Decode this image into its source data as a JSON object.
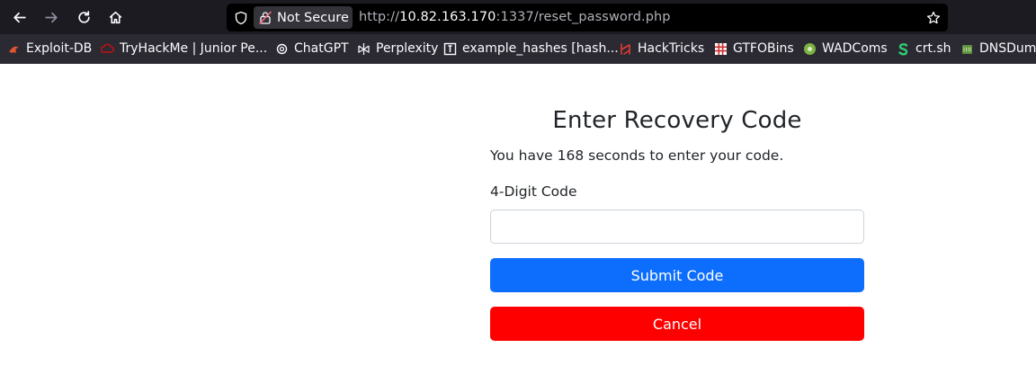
{
  "browser": {
    "security_label": "Not Secure",
    "url_prefix": "http://",
    "url_host": "10.82.163.170",
    "url_rest": ":1337/reset_password.php",
    "icons": {
      "back": "arrow-left-icon",
      "forward": "arrow-right-icon",
      "reload": "reload-icon",
      "home": "home-icon",
      "tracking": "shield-icon",
      "insecure": "lock-insecure-icon",
      "bookmark": "star-icon"
    }
  },
  "bookmarks": [
    {
      "label": "Exploit-DB",
      "icon": "exploit-db-icon",
      "color": "#e4572e"
    },
    {
      "label": "TryHackMe | Junior Pe...",
      "icon": "tryhackme-icon",
      "color": "#c11111"
    },
    {
      "label": "ChatGPT",
      "icon": "chatgpt-icon",
      "color": "#fbfbfe"
    },
    {
      "label": "Perplexity",
      "icon": "perplexity-icon",
      "color": "#fbfbfe"
    },
    {
      "label": "example_hashes [hash...",
      "icon": "hashcat-icon",
      "color": "#fbfbfe"
    },
    {
      "label": "HackTricks",
      "icon": "hacktricks-icon",
      "color": "#e03c31"
    },
    {
      "label": "GTFOBins",
      "icon": "gtfobins-icon",
      "color": "#d02d2d"
    },
    {
      "label": "WADComs",
      "icon": "wadcoms-icon",
      "color": "#7cb342"
    },
    {
      "label": "crt.sh",
      "icon": "crtsh-icon",
      "color": "#2ecc71"
    },
    {
      "label": "DNSDump",
      "icon": "dnsdumpster-icon",
      "color": "#5a8f3c"
    }
  ],
  "form": {
    "title": "Enter Recovery Code",
    "info": "You have 168 seconds to enter your code.",
    "code_label": "4-Digit Code",
    "code_value": "",
    "code_placeholder": "",
    "submit_label": "Submit Code",
    "cancel_label": "Cancel"
  },
  "colors": {
    "submit": "#0d6efd",
    "cancel": "#ff0000"
  }
}
